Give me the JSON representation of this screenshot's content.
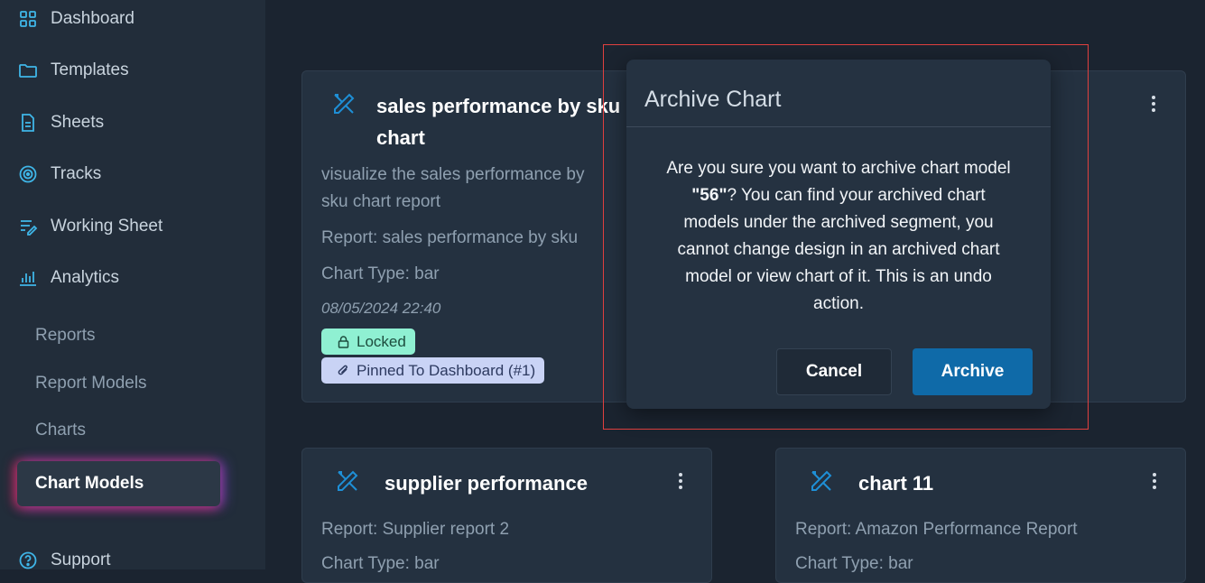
{
  "sidebar": {
    "items": [
      {
        "label": "Dashboard",
        "icon": "dashboard-icon"
      },
      {
        "label": "Templates",
        "icon": "folder-icon"
      },
      {
        "label": "Sheets",
        "icon": "document-icon"
      },
      {
        "label": "Tracks",
        "icon": "target-icon"
      },
      {
        "label": "Working Sheet",
        "icon": "edit-list-icon"
      },
      {
        "label": "Analytics",
        "icon": "bar-chart-icon"
      }
    ],
    "analytics_subitems": [
      "Reports",
      "Report Models",
      "Charts",
      "Chart Models"
    ],
    "active_subitem": "Chart Models",
    "support": {
      "label": "Support",
      "icon": "help-icon"
    }
  },
  "cards": [
    {
      "title": "sales performance by sku chart",
      "title_line1": "sales performance by sku",
      "title_line2": "chart",
      "description_line1": "visualize the sales performance by",
      "description_line2": "sku chart report",
      "report": "Report: sales performance by sku",
      "chart_type": "Chart Type: bar",
      "date": "08/05/2024 22:40",
      "badges": {
        "locked": "Locked",
        "pinned": "Pinned To Dashboard (#1)"
      }
    },
    {
      "title": "supplier performance",
      "report": "Report: Supplier report 2",
      "chart_type": "Chart Type: bar"
    },
    {
      "title": "chart 11",
      "report": "Report: Amazon Performance Report",
      "chart_type": "Chart Type: bar"
    }
  ],
  "modal": {
    "title": "Archive Chart",
    "body_before": "Are you sure you want to archive chart model ",
    "body_model": "\"56\"",
    "body_after": "? You can find your archived chart models under the archived segment, you cannot change design in an archived chart model or view chart of it. This is an undo action.",
    "cancel_label": "Cancel",
    "archive_label": "Archive"
  },
  "colors": {
    "background": "#1b2430",
    "sidebar": "#222d3a",
    "card": "#243140",
    "accent_blue": "#0f6aa8",
    "icon_blue": "#1e8fd6",
    "locked_badge": "#8ff0d2",
    "pinned_badge": "#c9d3f5",
    "highlight_border": "#e0403f"
  }
}
